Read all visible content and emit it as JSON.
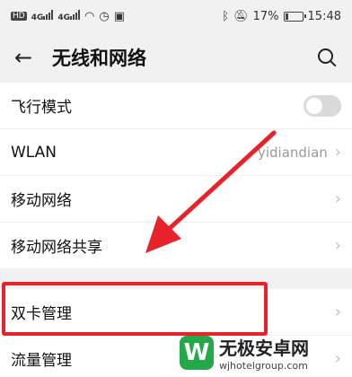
{
  "status_bar": {
    "left_icons": [
      "hd-icon",
      "signal-4g-icon",
      "signal-4g-icon",
      "wifi-icon",
      "alarm-icon",
      "notification-icon"
    ],
    "hd_label": "HD",
    "net_label": "4G",
    "battery_percent": "17%",
    "battery_level": 0.17,
    "time": "15:48"
  },
  "header": {
    "title": "无线和网络"
  },
  "list": {
    "items": [
      {
        "label": "飞行模式",
        "value": "",
        "control": "toggle",
        "toggle_on": false
      },
      {
        "label": "WLAN",
        "value": "yidiandian",
        "control": "chevron"
      },
      {
        "label": "移动网络",
        "value": "",
        "control": "chevron"
      },
      {
        "label": "移动网络共享",
        "value": "",
        "control": "chevron"
      },
      {
        "label": "双卡管理",
        "value": "",
        "control": "chevron"
      },
      {
        "label": "流量管理",
        "value": "",
        "control": "chevron"
      }
    ]
  },
  "annotation": {
    "highlight_color": "#e8222a",
    "arrow_color": "#e8222a"
  },
  "watermark": {
    "logo_letter": "W",
    "name": "无极安卓网",
    "url": "wjhotelgroup.com"
  },
  "colors": {
    "background": "#f1f1f1",
    "row_background": "#ffffff",
    "brand_green": "#24a84a"
  }
}
